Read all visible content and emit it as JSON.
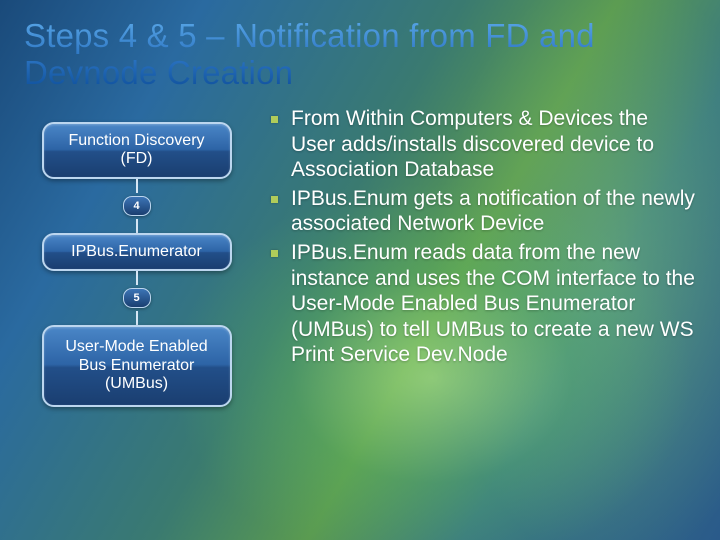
{
  "title": "Steps 4 & 5 – Notification from FD and Devnode Creation",
  "diagram": {
    "nodes": [
      {
        "label": "Function Discovery (FD)"
      },
      {
        "label": "IPBus.Enumerator"
      },
      {
        "label": "User-Mode Enabled Bus Enumerator (UMBus)"
      }
    ],
    "steps": [
      "4",
      "5"
    ]
  },
  "bullets": [
    "From Within Computers & Devices the User adds/installs discovered device to Association Database",
    "IPBus.Enum gets a  notification of the newly associated Network Device",
    "IPBus.Enum reads data from the new instance and uses the COM interface to the User-Mode Enabled Bus Enumerator (UMBus) to tell UMBus to create a new WS Print Service Dev.Node"
  ]
}
